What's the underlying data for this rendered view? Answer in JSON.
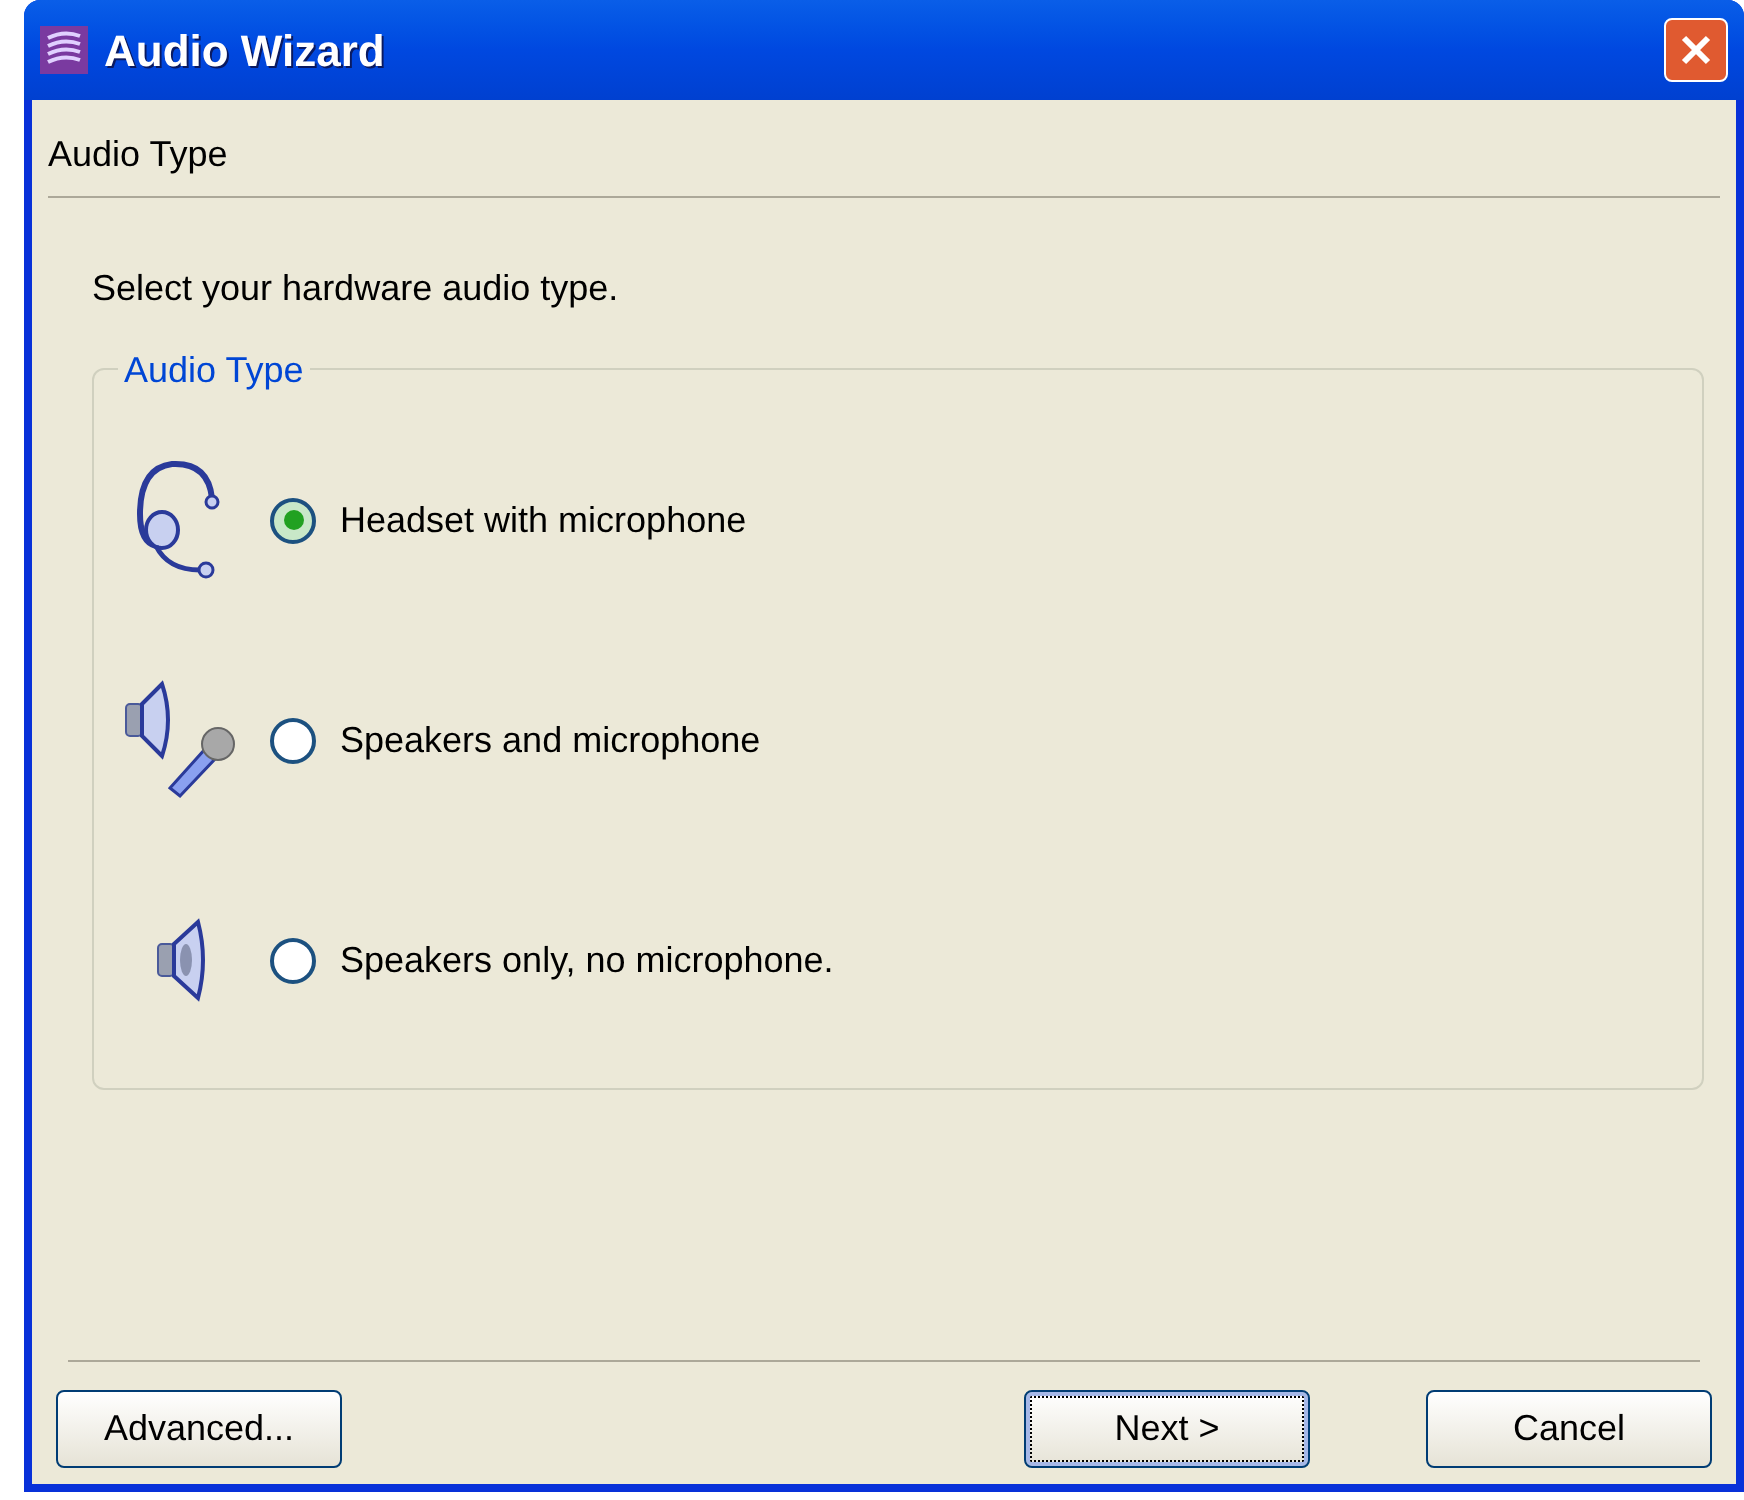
{
  "window": {
    "title": "Audio Wizard"
  },
  "page_title": "Audio Type",
  "instruction": "Select your hardware audio type.",
  "group": {
    "label": "Audio Type",
    "options": [
      {
        "kind": "headset",
        "label": "Headset with microphone",
        "selected": true
      },
      {
        "kind": "speaker-mic",
        "label": "Speakers and microphone",
        "selected": false
      },
      {
        "kind": "speaker",
        "label": "Speakers only, no microphone.",
        "selected": false
      }
    ]
  },
  "buttons": [
    {
      "label": "Advanced...",
      "focused": false
    },
    {
      "label": "Next >",
      "focused": true
    },
    {
      "label": "Cancel",
      "focused": false
    }
  ]
}
